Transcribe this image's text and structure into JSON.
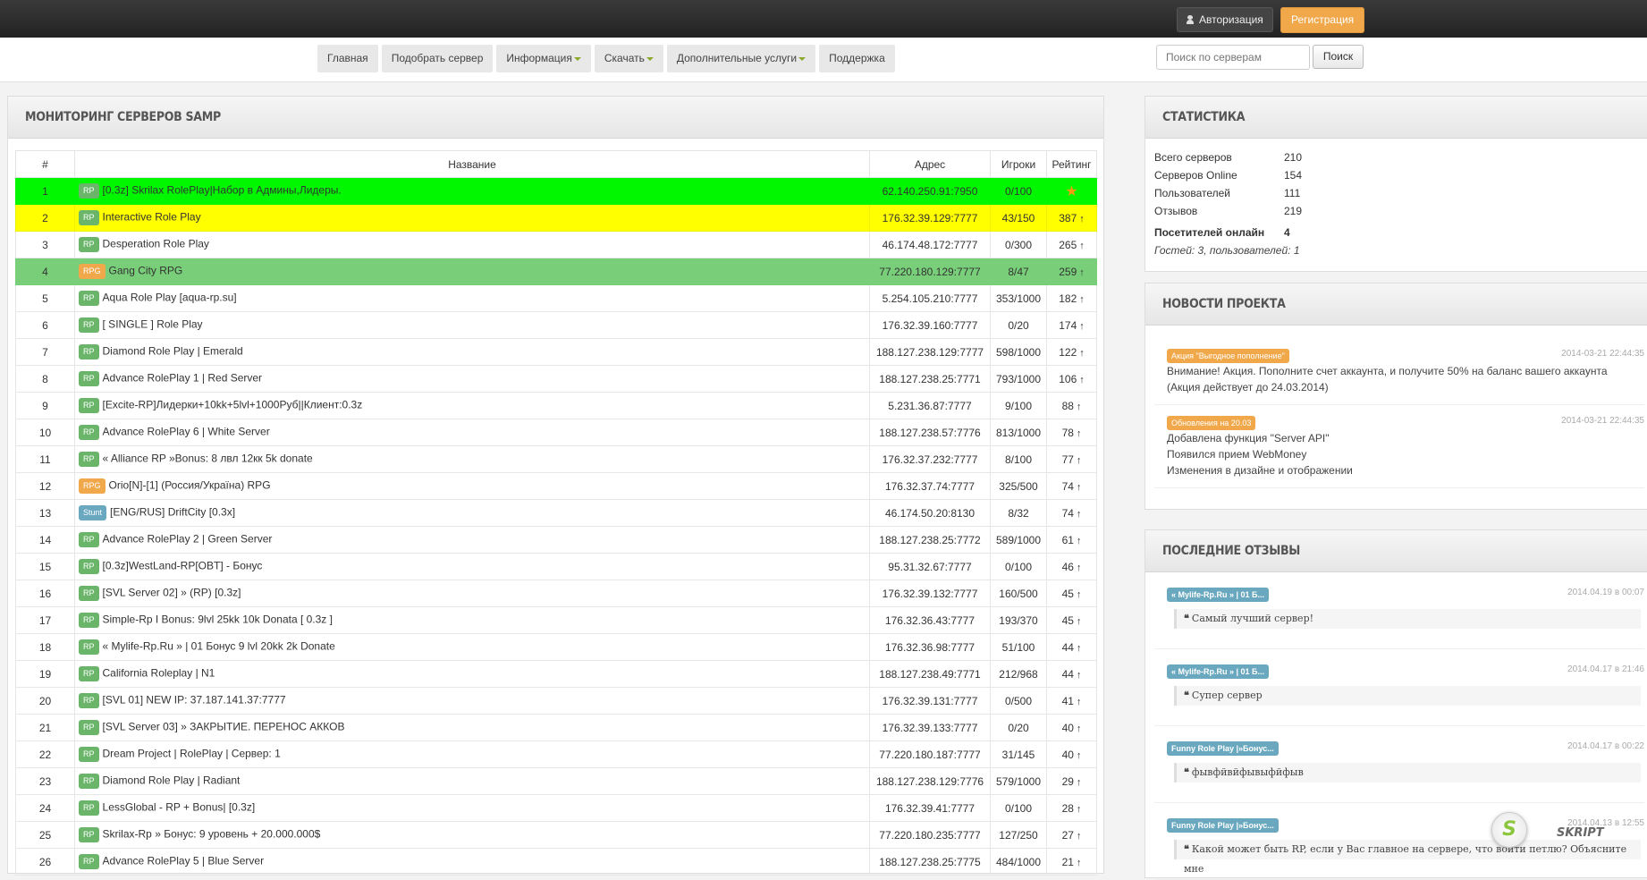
{
  "header": {
    "auth_label": "Авторизация",
    "register_label": "Регистрация"
  },
  "nav": {
    "items": [
      "Главная",
      "Подобрать сервер",
      "Информация",
      "Скачать",
      "Дополнительные услуги",
      "Поддержка"
    ],
    "search_placeholder": "Поиск по серверам",
    "search_button": "Поиск"
  },
  "main": {
    "title": "МОНИТОРИНГ СЕРВЕРОВ SAMP",
    "columns": [
      "#",
      "Название",
      "Адрес",
      "Игроки",
      "Рейтинг"
    ],
    "rows": [
      {
        "n": "1",
        "badge": "RP",
        "name": "[0.3z] Skrilax RolePlay|Набор в Админы,Лидеры.",
        "addr": "62.140.250.91:7950",
        "players": "0/100",
        "rating": "",
        "hl": "g",
        "star": true
      },
      {
        "n": "2",
        "badge": "RP",
        "name": "Interactive Role Play",
        "addr": "176.32.39.129:7777",
        "players": "43/150",
        "rating": "387",
        "hl": "y"
      },
      {
        "n": "3",
        "badge": "RP",
        "name": "Desperation Role Play",
        "addr": "46.174.48.172:7777",
        "players": "0/300",
        "rating": "265",
        "hl": ""
      },
      {
        "n": "4",
        "badge": "RPG",
        "name": "Gang City RPG",
        "addr": "77.220.180.129:7777",
        "players": "8/47",
        "rating": "259",
        "hl": "m"
      },
      {
        "n": "5",
        "badge": "RP",
        "name": "Aqua Role Play [aqua-rp.su]",
        "addr": "5.254.105.210:7777",
        "players": "353/1000",
        "rating": "182",
        "hl": ""
      },
      {
        "n": "6",
        "badge": "RP",
        "name": "[ SINGLE ] Role Play",
        "addr": "176.32.39.160:7777",
        "players": "0/20",
        "rating": "174",
        "hl": ""
      },
      {
        "n": "7",
        "badge": "RP",
        "name": "Diamond Role Play | Emerald",
        "addr": "188.127.238.129:7777",
        "players": "598/1000",
        "rating": "122",
        "hl": ""
      },
      {
        "n": "8",
        "badge": "RP",
        "name": "Advance RolePlay 1 | Red Server",
        "addr": "188.127.238.25:7771",
        "players": "793/1000",
        "rating": "106",
        "hl": ""
      },
      {
        "n": "9",
        "badge": "RP",
        "name": "[Excite-RP]Лидерки+10kk+5lvl+1000Руб||Клиент:0.3z",
        "addr": "5.231.36.87:7777",
        "players": "9/100",
        "rating": "88",
        "hl": ""
      },
      {
        "n": "10",
        "badge": "RP",
        "name": "Advance RolePlay 6 | White Server",
        "addr": "188.127.238.57:7776",
        "players": "813/1000",
        "rating": "78",
        "hl": ""
      },
      {
        "n": "11",
        "badge": "RP",
        "name": "« Alliance RP »Bonus: 8 лвл 12кк 5k donate",
        "addr": "176.32.37.232:7777",
        "players": "8/100",
        "rating": "77",
        "hl": ""
      },
      {
        "n": "12",
        "badge": "RPG",
        "name": "Orio[N]-[1] (Россия/Україна) RPG",
        "addr": "176.32.37.74:7777",
        "players": "325/500",
        "rating": "74",
        "hl": ""
      },
      {
        "n": "13",
        "badge": "Stunt",
        "name": "[ENG/RUS] DriftCity [0.3x]",
        "addr": "46.174.50.20:8130",
        "players": "8/32",
        "rating": "74",
        "hl": ""
      },
      {
        "n": "14",
        "badge": "RP",
        "name": "Advance RolePlay 2 | Green Server",
        "addr": "188.127.238.25:7772",
        "players": "589/1000",
        "rating": "61",
        "hl": ""
      },
      {
        "n": "15",
        "badge": "RP",
        "name": "[0.3z]WestLand-RP[OBT] - Бонус",
        "addr": "95.31.32.67:7777",
        "players": "0/100",
        "rating": "46",
        "hl": ""
      },
      {
        "n": "16",
        "badge": "RP",
        "name": "[SVL Server 02] » (RP) [0.3z]",
        "addr": "176.32.39.132:7777",
        "players": "160/500",
        "rating": "45",
        "hl": ""
      },
      {
        "n": "17",
        "badge": "RP",
        "name": "Simple-Rp I Bonus: 9lvl 25kk 10k Donata [ 0.3z ]",
        "addr": "176.32.36.43:7777",
        "players": "193/370",
        "rating": "45",
        "hl": ""
      },
      {
        "n": "18",
        "badge": "RP",
        "name": "« Mylife-Rp.Ru » | 01 Бонус 9 lvl 20kk 2k Donate",
        "addr": "176.32.36.98:7777",
        "players": "51/100",
        "rating": "44",
        "hl": ""
      },
      {
        "n": "19",
        "badge": "RP",
        "name": "California Roleplay | N1",
        "addr": "188.127.238.49:7771",
        "players": "212/968",
        "rating": "44",
        "hl": ""
      },
      {
        "n": "20",
        "badge": "RP",
        "name": "[SVL 01] NEW IP: 37.187.141.37:7777",
        "addr": "176.32.39.131:7777",
        "players": "0/500",
        "rating": "41",
        "hl": ""
      },
      {
        "n": "21",
        "badge": "RP",
        "name": "[SVL Server 03] » ЗАКРЫТИЕ. ПЕРЕНОС АККОВ",
        "addr": "176.32.39.133:7777",
        "players": "0/20",
        "rating": "40",
        "hl": ""
      },
      {
        "n": "22",
        "badge": "RP",
        "name": "Dream Project | RolePlay | Сервер: 1",
        "addr": "77.220.180.187:7777",
        "players": "31/145",
        "rating": "40",
        "hl": ""
      },
      {
        "n": "23",
        "badge": "RP",
        "name": "Diamond Role Play | Radiant",
        "addr": "188.127.238.129:7776",
        "players": "579/1000",
        "rating": "29",
        "hl": ""
      },
      {
        "n": "24",
        "badge": "RP",
        "name": "LessGlobal - RP + Bonus| [0.3z]",
        "addr": "176.32.39.41:7777",
        "players": "0/100",
        "rating": "28",
        "hl": ""
      },
      {
        "n": "25",
        "badge": "RP",
        "name": "Skrilax-Rp » Бонус: 9 уровень + 20.000.000$",
        "addr": "77.220.180.235:7777",
        "players": "127/250",
        "rating": "27",
        "hl": ""
      },
      {
        "n": "26",
        "badge": "RP",
        "name": "Advance RolePlay 5 | Blue Server",
        "addr": "188.127.238.25:7775",
        "players": "484/1000",
        "rating": "21",
        "hl": ""
      }
    ]
  },
  "stats": {
    "title": "СТАТИСТИКА",
    "rows": [
      {
        "k": "Всего серверов",
        "v": "210"
      },
      {
        "k": "Серверов Online",
        "v": "154"
      },
      {
        "k": "Пользователей",
        "v": "111"
      },
      {
        "k": "Отзывов",
        "v": "219"
      }
    ],
    "visitors_label": "Посетителей онлайн",
    "visitors_value": "4",
    "guests": "Гостей: 3, пользователей: 1"
  },
  "news": {
    "title": "НОВОСТИ ПРОЕКТА",
    "items": [
      {
        "tag": "Акция \"Выгодное пополнение\"",
        "date": "2014-03-21 22:44:35",
        "lines": [
          "Внимание! Акция. Пополните счет аккаунта, и получите 50% на баланс вашего аккаунта",
          "(Акция действует до 24.03.2014)"
        ]
      },
      {
        "tag": "Обновления на 20.03",
        "date": "2014-03-21 22:44:35",
        "lines": [
          "Добавлена функция \"Server API\"",
          "Появился прием WebMoney",
          "Изменения в дизайне и отображении"
        ]
      }
    ]
  },
  "reviews": {
    "title": "ПОСЛЕДНИЕ ОТЗЫВЫ",
    "items": [
      {
        "server": "« Mylife-Rp.Ru » | 01 Б...",
        "date": "2014.04.19 в 00:07",
        "text": "Самый лучший сервер!"
      },
      {
        "server": "« Mylife-Rp.Ru » | 01 Б...",
        "date": "2014.04.17 в 21:46",
        "text": "Супер сервер"
      },
      {
        "server": "Funny Role Play |»Бонус...",
        "date": "2014.04.17 в 00:22",
        "text": "фывфйвйфывыфйфыв"
      },
      {
        "server": "Funny Role Play |»Бонус...",
        "date": "2014.04.13 в 12:55",
        "text": "Какой может быть RP, если у Вас главное на сервере, что войти петлю? Объясните мне"
      }
    ]
  },
  "brand": {
    "text": "SKRIPT"
  },
  "colors": {
    "highlight_green": "#00f700",
    "highlight_yellow": "#ffff00",
    "highlight_mid": "#79cf79",
    "accent_orange": "#f0a84a"
  }
}
